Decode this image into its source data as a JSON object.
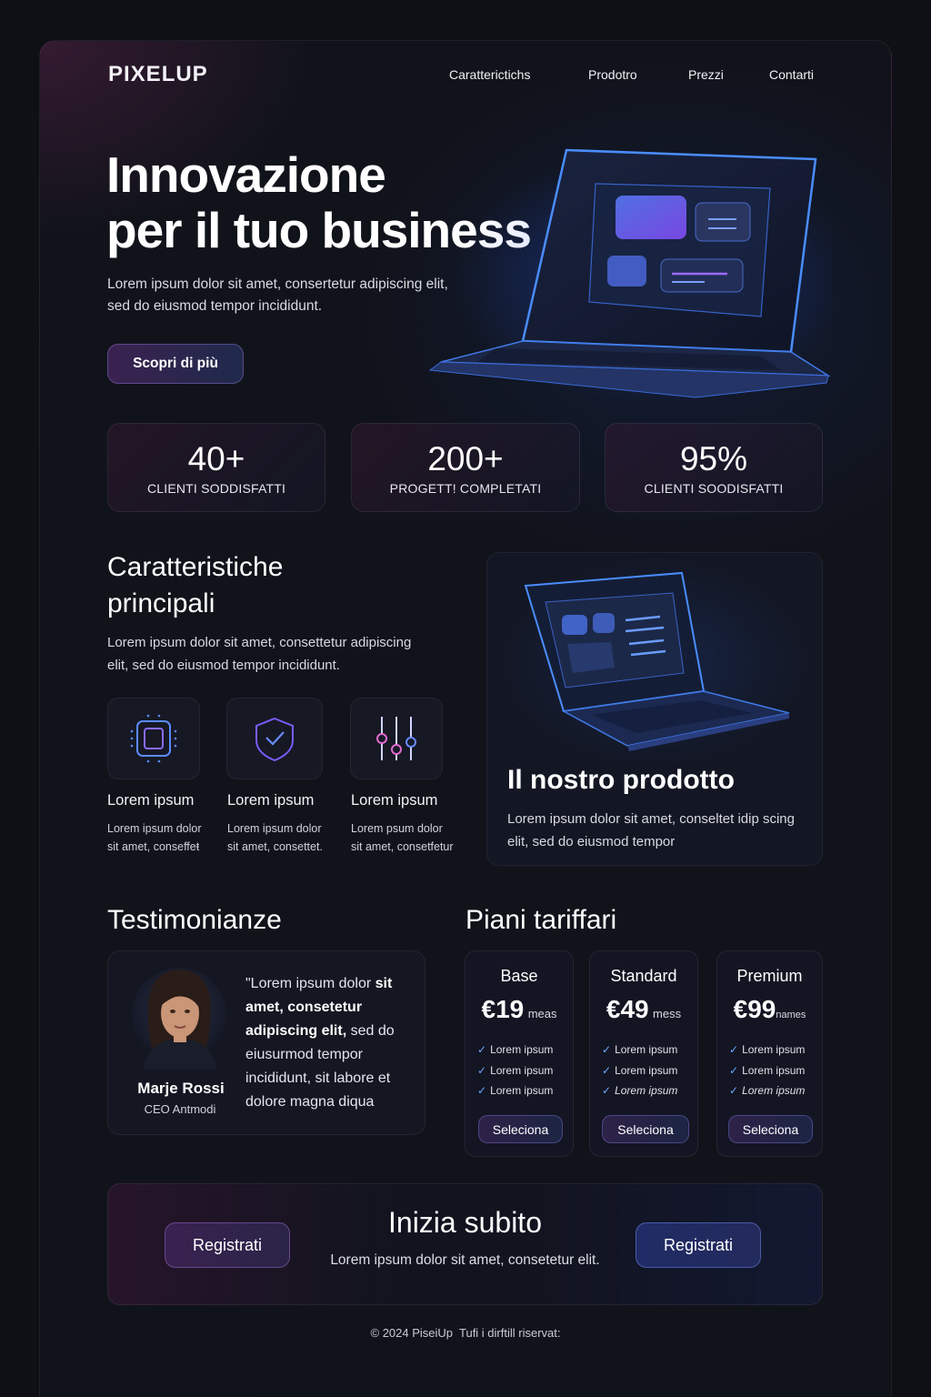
{
  "brand": {
    "logo": "PIXELUP"
  },
  "nav": {
    "items": [
      "Caratterictichs",
      "Prodotro",
      "Prezzi",
      "Contarti"
    ]
  },
  "hero": {
    "title_line1": "Innovazione",
    "title_line2": "per il tuo business",
    "subtitle_line1": "Lorem ipsum dolor sit amet, consertetur adipiscing elit,",
    "subtitle_line2": "sed do eiusmod tempor incididunt.",
    "cta": "Scopri di più"
  },
  "stats": [
    {
      "value": "40+",
      "label": "CLIENTI SODDISFATTI"
    },
    {
      "value": "200+",
      "label": "PROGETT! COMPLETATI"
    },
    {
      "value": "95%",
      "label": "CLIENTI SOODISFATTI"
    }
  ],
  "features": {
    "title_line1": "Caratteristiche",
    "title_line2": "principali",
    "desc_line1": "Lorem ipsum dolor sit amet, consettetur adipiscing",
    "desc_line2": "elit, sed do eiusmod tempor incididunt.",
    "items": [
      {
        "icon": "chip-icon",
        "title": "Lorem ipsum",
        "line1": "Lorem ipsum dolor",
        "line2": "sit amet, conseffeŧ"
      },
      {
        "icon": "shield-check-icon",
        "title": "Lorem ipsum",
        "line1": "Lorem ipsum dolor",
        "line2": "sit amet, consettet."
      },
      {
        "icon": "sliders-icon",
        "title": "Lorem ipsum",
        "line1": "Lorem psum dolor",
        "line2": "sit amet, consetfetur"
      }
    ]
  },
  "product": {
    "title": "Il nostro prodotto",
    "desc_line1": "Lorem ipsum dolor sit amet, conseltet idip scing",
    "desc_line2": "elit, sed do eiusmod tempor"
  },
  "testimonials": {
    "title": "Testimonianze",
    "quote_pre": "\"Lorem ipsum dolor",
    "quote_bold": "sit amet, consetetur adipiscing elit,",
    "quote_post": "sed do eiusurmod tempor incididunt,  sit labore et dolore magna diqua",
    "name": "Marje Rossi",
    "role": "CEO Antmodi"
  },
  "pricing": {
    "title": "Piani tariffari",
    "plans": [
      {
        "name": "Base",
        "price": "€19",
        "period": "meas",
        "features": [
          "Lorem ipsum",
          "Lorem ipsum",
          "Lorem ipsum"
        ],
        "cta": "Seleciona"
      },
      {
        "name": "Standard",
        "price": "€49",
        "period": "mess",
        "features": [
          "Lorem ipsum",
          "Lorem ipsum",
          "Lorem ipsum"
        ],
        "cta": "Seleciona"
      },
      {
        "name": "Premium",
        "price": "€99",
        "period": "names",
        "features": [
          "Lorem ipsum",
          "Lorem ipsum",
          "Lorem ipsum"
        ],
        "cta": "Seleciona"
      }
    ]
  },
  "cta": {
    "title": "Inizia subito",
    "subtitle": "Lorem ipsum dolor sit amet, consetetur elit.",
    "left_button": "Registrati",
    "right_button": "Registrati"
  },
  "footer": {
    "text": "© 2024 PiseiUp  Tufi i dirftill riservat:"
  },
  "colors": {
    "background": "#0e1016",
    "accent_purple": "#8a5cff",
    "accent_blue": "#3f8cff",
    "text": "#eef0f6"
  }
}
